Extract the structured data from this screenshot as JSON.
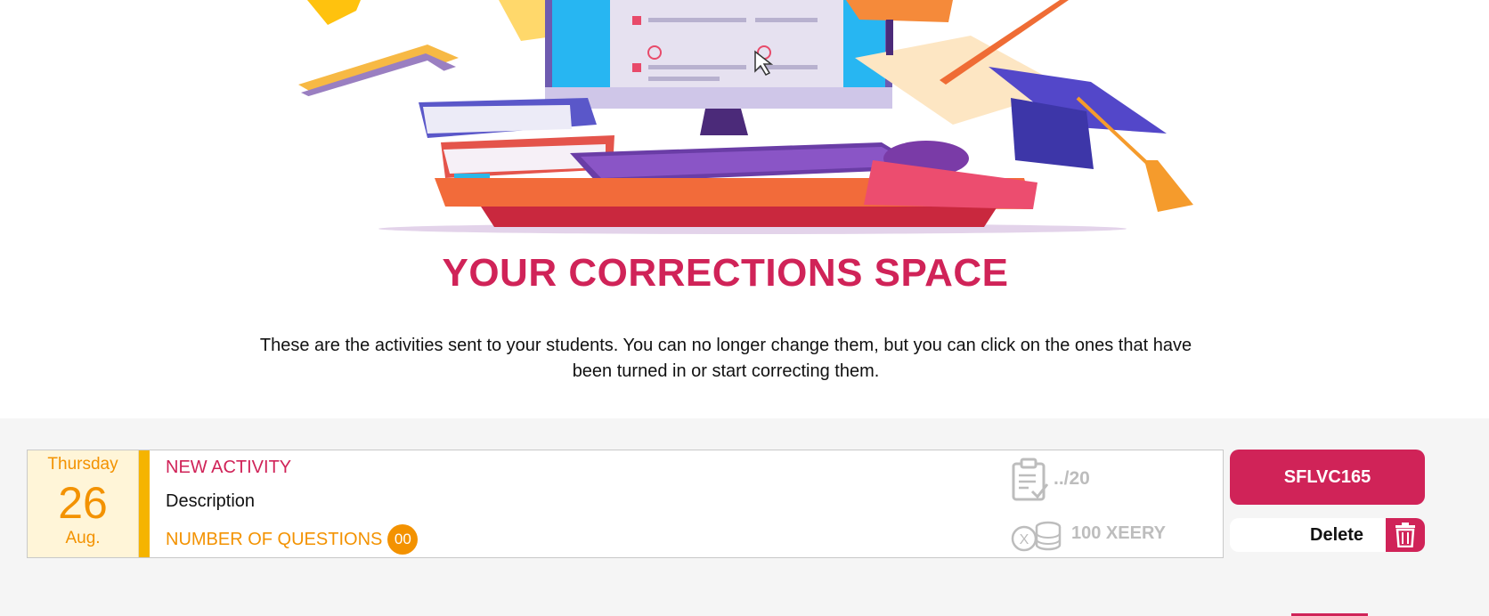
{
  "page": {
    "title": "YOUR CORRECTIONS SPACE",
    "subtitle": "These are the activities sent to your students. You can no longer change them, but you can click on the ones that have been turned in or start correcting them."
  },
  "hero": {
    "illustration": "education-computer-illustration"
  },
  "activities": [
    {
      "date": {
        "weekday": "Thursday",
        "day": "26",
        "month": "Aug."
      },
      "name": "NEW ACTIVITY",
      "description": "Description",
      "questions_label": "NUMBER OF QUESTIONS",
      "questions_count": "00",
      "grade": "../20",
      "grade_icon": "clipboard-check-icon",
      "reward": "100 XEERY",
      "reward_icon": "coins-icon",
      "code": "SFLVC165",
      "delete_label": "Delete",
      "delete_icon": "trash-icon"
    }
  ],
  "colors": {
    "primary": "#d02358",
    "accent": "#f39200",
    "date_bg": "#fff5d8",
    "bar": "#f5b400"
  }
}
